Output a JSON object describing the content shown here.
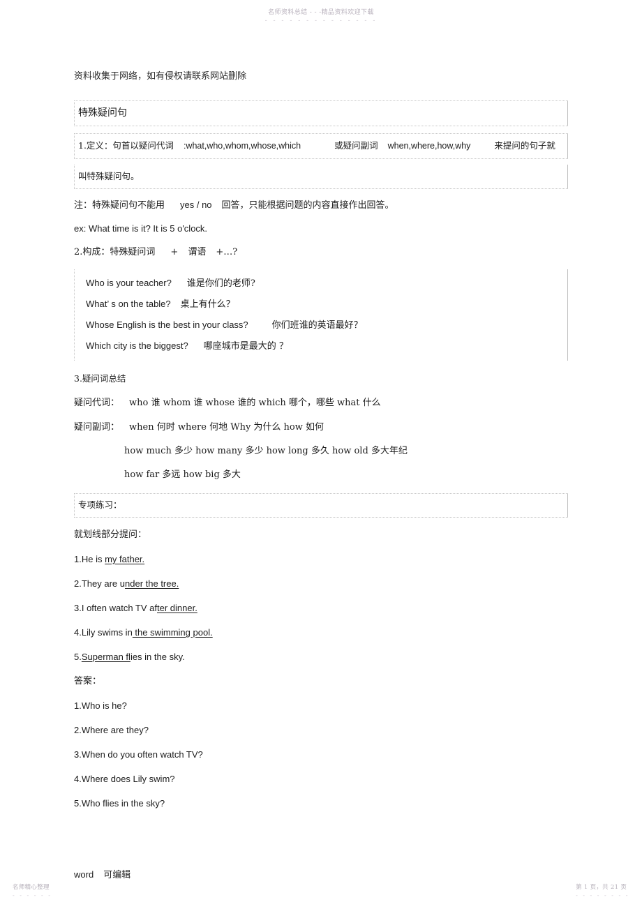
{
  "watermark": {
    "top_text": "名师资料总结 - - -精品资料欢迎下载",
    "top_dashes": "- - - - - - - - - - - - - -"
  },
  "notice": "资料收集于网络，如有侵权请联系网站删除",
  "title": "特殊疑问句",
  "definition": {
    "line1_a": "1.定义：句首以疑问代词",
    "line1_b": ":what,who,whom,whose,which",
    "line1_c": "或疑问副词",
    "line1_d": "when,where,how,why",
    "line1_e": "来提问的句子就",
    "line2": "叫特殊疑问句。"
  },
  "note": {
    "a": "注：特殊疑问句不能用",
    "b": "yes / no",
    "c": "回答，只能根据问题的内容直接作出回答。"
  },
  "example_sentence": "ex: What time is it? It is 5 o'clock.",
  "structure": {
    "a": "2.构成：特殊疑问词",
    "b": "+",
    "c": "谓语",
    "d": "+…?"
  },
  "examples": [
    {
      "en": "Who is your teacher?",
      "cn": "谁是你们的老师?"
    },
    {
      "en": "What’ s on the table?",
      "cn": "桌上有什么？"
    },
    {
      "en": "Whose English is the best in your class?",
      "cn": "你们班谁的英语最好？"
    },
    {
      "en": "Which city is the biggest?",
      "cn": "哪座城市是最大的  ？"
    }
  ],
  "summary": {
    "heading": "3.疑问词总结",
    "pronouns_label": "疑问代词：",
    "pronouns": "who 谁  whom  谁 whose  谁的  which  哪个，哪些   what  什么",
    "adverbs_label": "疑问副词：",
    "adverbs": "when  何时  where  何地    Why  为什么  how  如何",
    "how_line1": "how much  多少  how many  多少  how long  多久  how old  多大年纪",
    "how_line2": "how far  多远  how big  多大"
  },
  "practice": {
    "box_label": "专项练习：",
    "instruction": "就划线部分提问：",
    "questions": [
      {
        "num": "1.",
        "pre": "He is ",
        "underlined": "my father.",
        "post": "   "
      },
      {
        "num": "2.",
        "pre": "They are u",
        "underlined": "nder the tree.",
        "post": "   "
      },
      {
        "num": "3.",
        "pre": "I often watch TV af",
        "underlined": "ter dinner.",
        "post": "   "
      },
      {
        "num": "4.",
        "pre": "Lily swims in",
        "underlined": " the swimming pool.",
        "post": "   "
      },
      {
        "num": "5.",
        "pre": "",
        "underlined": "Superman fl",
        "post": "ies in the sky."
      }
    ],
    "answers_label": "答案：",
    "answers": [
      "1.Who is he?",
      "2.Where are they?",
      "3.When do you often watch TV?",
      "4.Where does Lily swim?",
      "5.Who flies in the sky?"
    ]
  },
  "footer_note": {
    "word": "word",
    "editable": "可编辑"
  },
  "page_footer": {
    "left": "名师精心整理",
    "left_dashes": "- - - - - -",
    "right": "第 1 页，共 21 页",
    "right_dashes": "- - - - - - - -"
  }
}
